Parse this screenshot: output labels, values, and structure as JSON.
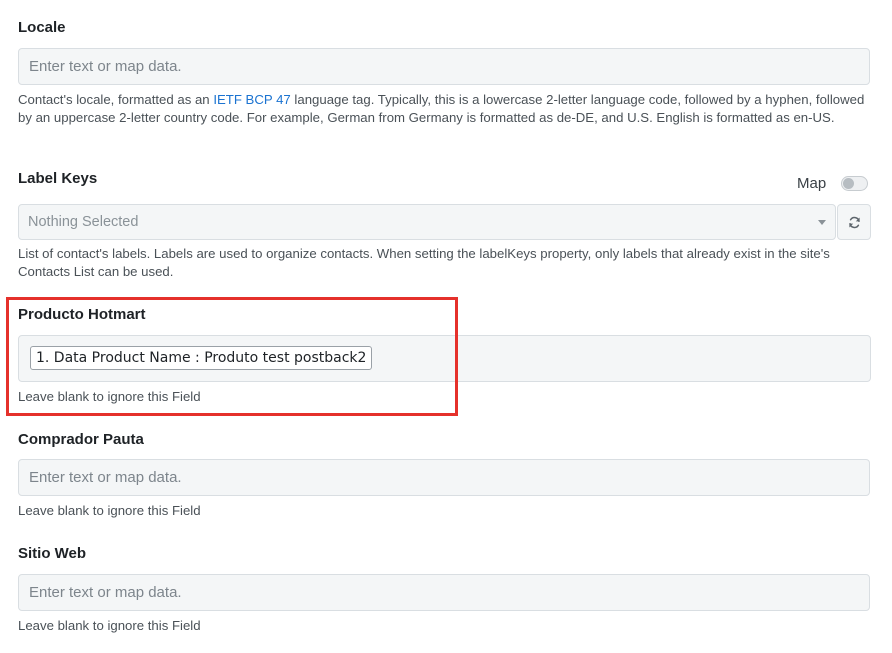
{
  "locale": {
    "label": "Locale",
    "placeholder": "Enter text or map data.",
    "help_prefix": "Contact's locale, formatted as an ",
    "help_link": "IETF BCP 47",
    "help_suffix": " language tag. Typically, this is a lowercase 2-letter language code, followed by a hyphen, followed by an uppercase 2-letter country code. For example, German from Germany is formatted as de-DE, and U.S. English is formatted as en-US."
  },
  "label_keys": {
    "label": "Label Keys",
    "map_label": "Map",
    "map_enabled": false,
    "selected": "Nothing Selected",
    "refresh_icon": "refresh-icon",
    "help": "List of contact's labels. Labels are used to organize contacts. When setting the labelKeys property, only labels that already exist in the site's Contacts List can be used."
  },
  "producto_hotmart": {
    "label": "Producto Hotmart",
    "mapped_value": "1. Data Product Name : Produto test postback2",
    "help": "Leave blank to ignore this Field",
    "highlight_color": "#e5312b"
  },
  "comprador_pauta": {
    "label": "Comprador Pauta",
    "placeholder": "Enter text or map data.",
    "help": "Leave blank to ignore this Field"
  },
  "sitio_web": {
    "label": "Sitio Web",
    "placeholder": "Enter text or map data.",
    "help": "Leave blank to ignore this Field"
  }
}
